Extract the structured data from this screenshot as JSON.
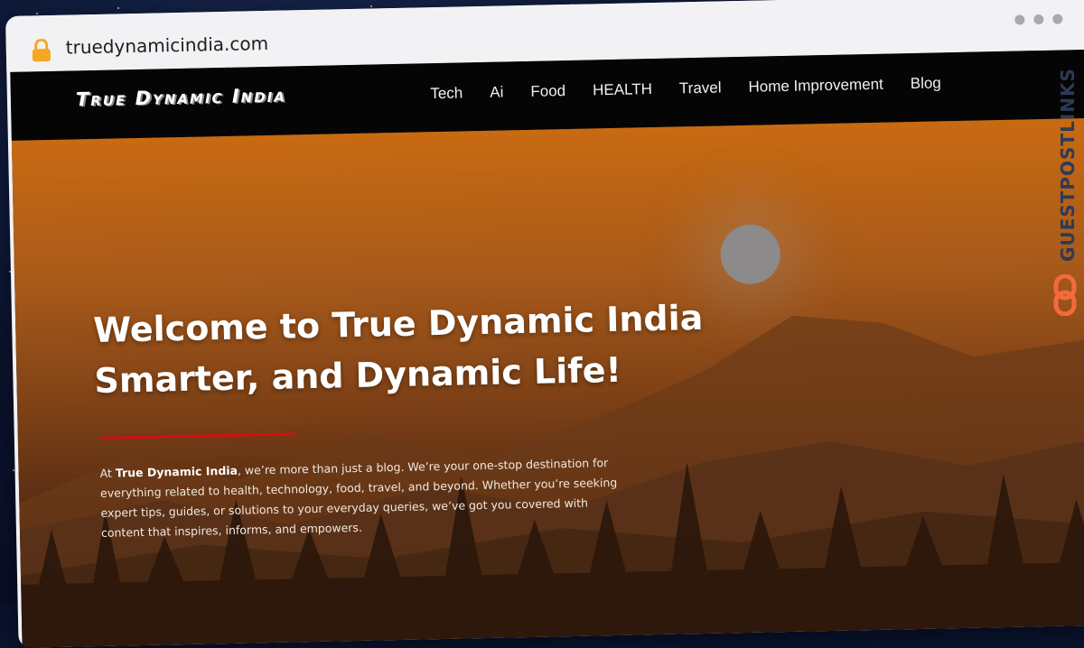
{
  "browser": {
    "url": "truedynamicindia.com",
    "lock_icon": "lock-icon",
    "accent": "#f5a623"
  },
  "site": {
    "logo_text": "True Dynamic India",
    "nav": {
      "items": [
        {
          "label": "Tech"
        },
        {
          "label": "Ai"
        },
        {
          "label": "Food"
        },
        {
          "label": "HEALTH"
        },
        {
          "label": "Travel"
        },
        {
          "label": "Home Improvement"
        },
        {
          "label": "Blog"
        }
      ]
    },
    "hero": {
      "headline_line1": "Welcome to True Dynamic India",
      "headline_line2": "Smarter, and Dynamic Life!",
      "intro_prefix": "At ",
      "intro_brand": "True Dynamic India",
      "intro_rest": ", we’re more than just a blog. We’re your one-stop destination for everything related to health, technology, food, travel, and beyond. Whether you’re seeking expert tips, guides, or solutions to your everyday queries, we’ve got you covered with content that inspires, informs, and empowers."
    }
  },
  "watermark": {
    "text": "GUESTPOSTLINKS",
    "icon": "chain-link-icon",
    "text_color": "#2e3a55",
    "icon_color": "#f26b3a"
  }
}
